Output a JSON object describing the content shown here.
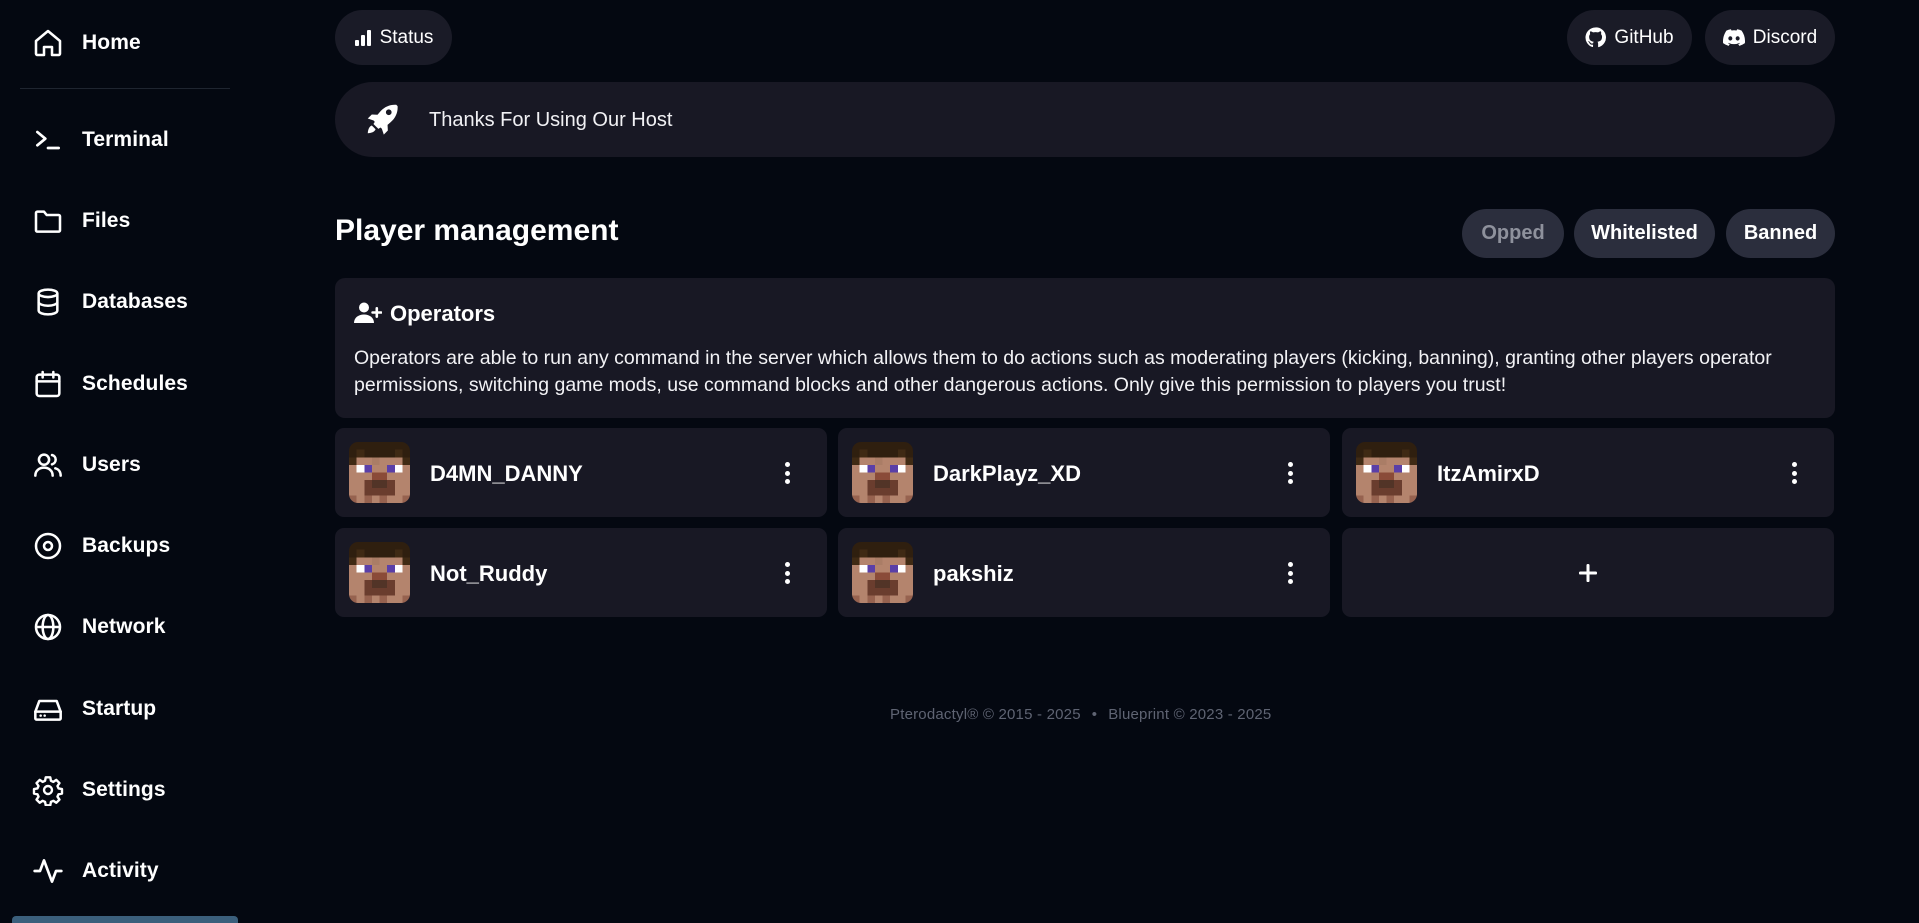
{
  "sidebar": {
    "items": [
      {
        "label": "Home",
        "icon": "home-icon"
      },
      {
        "label": "Terminal",
        "icon": "terminal-icon"
      },
      {
        "label": "Files",
        "icon": "folder-icon"
      },
      {
        "label": "Databases",
        "icon": "database-icon"
      },
      {
        "label": "Schedules",
        "icon": "calendar-icon"
      },
      {
        "label": "Users",
        "icon": "users-icon"
      },
      {
        "label": "Backups",
        "icon": "backup-disc-icon"
      },
      {
        "label": "Network",
        "icon": "globe-icon"
      },
      {
        "label": "Startup",
        "icon": "hard-drive-icon"
      },
      {
        "label": "Settings",
        "icon": "gear-icon"
      },
      {
        "label": "Activity",
        "icon": "activity-pulse-icon"
      }
    ]
  },
  "topbar": {
    "status_label": "Status",
    "github_label": "GitHub",
    "discord_label": "Discord"
  },
  "banner": {
    "text": "Thanks For Using Our Host",
    "icon": "rocket-icon"
  },
  "player_management": {
    "title": "Player management",
    "tabs": [
      {
        "label": "Opped",
        "active": false
      },
      {
        "label": "Whitelisted",
        "active": true
      },
      {
        "label": "Banned",
        "active": true
      }
    ],
    "info": {
      "title": "Operators",
      "icon": "user-plus-icon",
      "description": "Operators are able to run any command in the server which allows them to do actions such as moderating players (kicking, banning), granting other players operator permissions, switching game mods, use command blocks and other dangerous actions. Only give this permission to players you trust!"
    },
    "players": [
      {
        "name": "D4MN_DANNY"
      },
      {
        "name": "DarkPlayz_XD"
      },
      {
        "name": "ItzAmirxD"
      },
      {
        "name": "Not_Ruddy"
      },
      {
        "name": "pakshiz"
      }
    ],
    "add_label": "+"
  },
  "footer": {
    "left": "Pterodactyl® © 2015 - 2025",
    "separator": "•",
    "right": "Blueprint © 2023 - 2025"
  },
  "colors": {
    "background": "#040811",
    "card": "#181824",
    "pill": "#1a1b27",
    "tab": "#2b2e3d",
    "muted_text": "#8e919c"
  }
}
